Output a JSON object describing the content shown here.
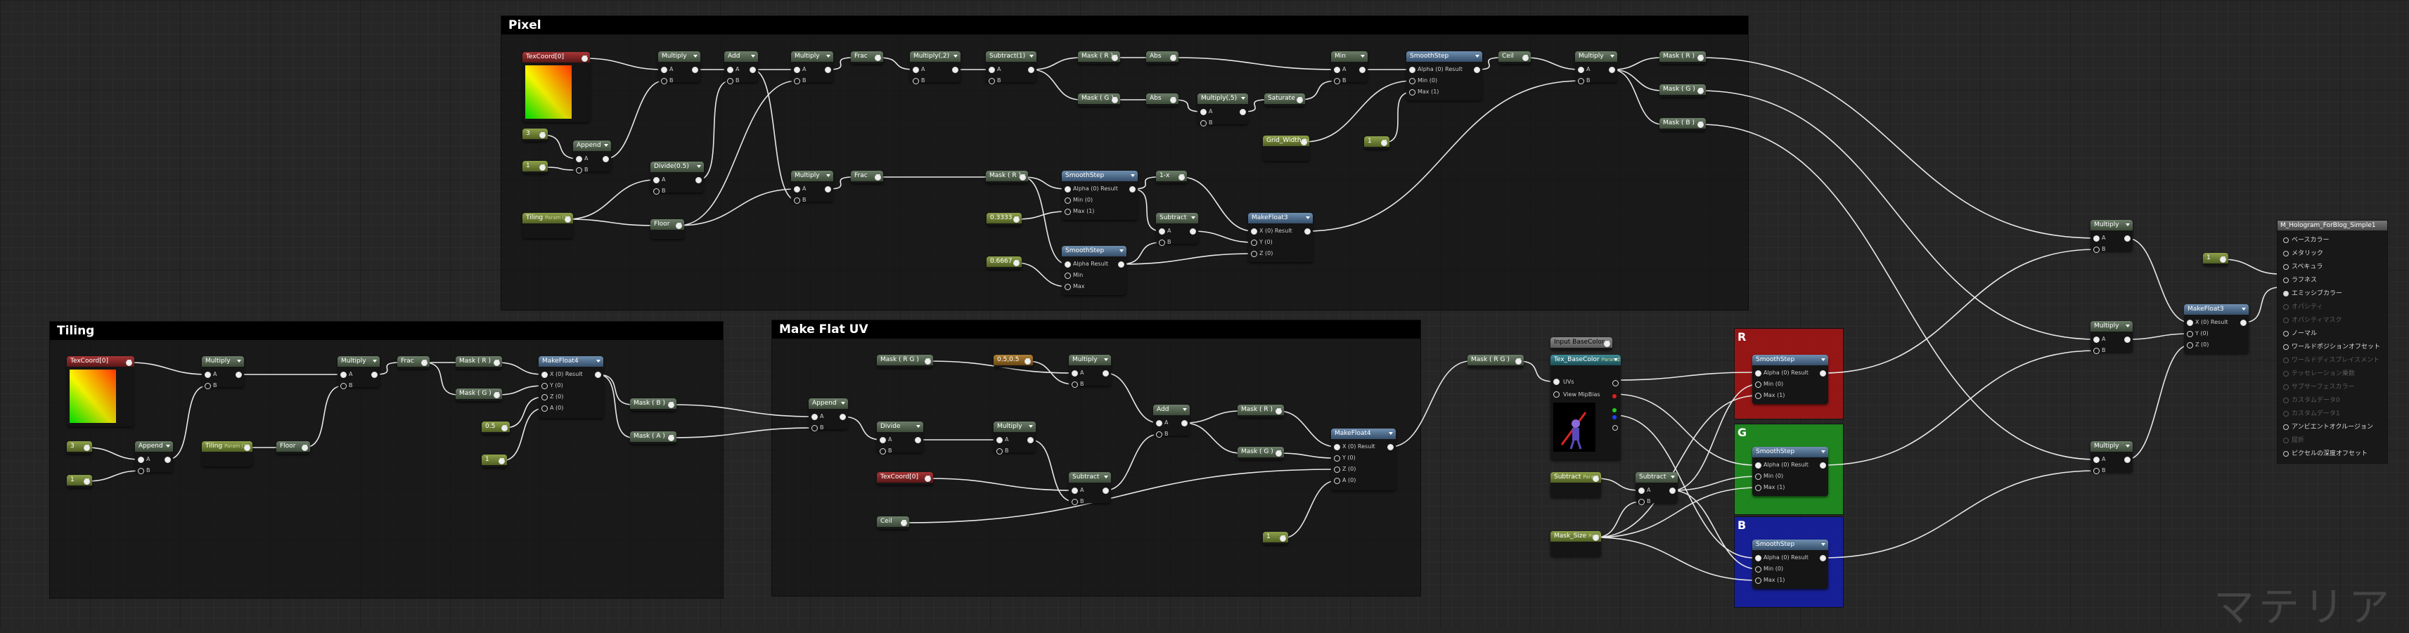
{
  "comments": {
    "pixel": "Pixel",
    "tiling": "Tiling",
    "flat_uv": "Make Flat UV",
    "r": "R",
    "g": "G",
    "b": "B"
  },
  "nodes": {
    "texcoord_pixel": "TexCoord[0]",
    "const3_a": "3",
    "const1_a": "1",
    "append_a": "Append",
    "tiling_param": "Tiling",
    "tiling_param_sub": "Param (1)",
    "multiply_a": "Multiply",
    "divide_a": "Divide(0.5)",
    "floor_a": "Floor",
    "add_a": "Add",
    "multiply_b": "Multiply",
    "multiply_c": "Multiply",
    "frac_a": "Frac",
    "frac_b": "Frac",
    "multiply_2": "Multiply(,2)",
    "subtract_1": "Subtract(1)",
    "mask_r_a": "Mask ( R )",
    "mask_g_a": "Mask ( G )",
    "abs_a": "Abs",
    "abs_b": "Abs",
    "multiply_5": "Multiply(,5)",
    "saturate": "Saturate",
    "min": "Min",
    "grid_width": "Grid_Width",
    "grid_width_sub": "Param (0.1)",
    "const1_b": "1",
    "smoothstep_a": "SmoothStep",
    "ceil_a": "Ceil",
    "multiply_d": "Multiply",
    "mask_r_b": "Mask ( R )",
    "mask_g_b": "Mask ( G )",
    "mask_b_b": "Mask ( B )",
    "mask_r_c": "Mask ( R )",
    "smoothstep_b": "SmoothStep",
    "const_3333": "0.3333",
    "const_6667": "0.6667",
    "smoothstep_c": "SmoothStep",
    "subtract_a": "Subtract",
    "one_minus": "1-x",
    "makefloat3_a": "MakeFloat3",
    "texcoord_tiling": "TexCoord[0]",
    "const3_b": "3",
    "const1_c": "1",
    "append_b": "Append",
    "tiling_param2": "Tiling",
    "tiling_param2_sub": "Param (1)",
    "multiply_e": "Multiply",
    "floor_b": "Floor",
    "multiply_f": "Multiply",
    "frac_c": "Frac",
    "mask_r_d": "Mask ( R )",
    "mask_g_d": "Mask ( G )",
    "const_05": "0.5",
    "const1_d": "1",
    "makefloat4_a": "MakeFloat4",
    "mask_rg": "Mask ( R G )",
    "append_c": "Append",
    "divide_b": "Divide",
    "texcoord_flat": "TexCoord[0]",
    "ceil_b": "Ceil",
    "const_05b": "0.5,0.5",
    "multiply_g": "Multiply",
    "multiply_h": "Multiply",
    "subtract_b": "Subtract",
    "add_b": "Add",
    "mask_r_e": "Mask ( R )",
    "mask_g_e": "Mask ( G )",
    "makefloat4_b": "MakeFloat4",
    "const1_e": "1",
    "mask_b_c": "Mask ( B )",
    "mask_a_c": "Mask ( A )",
    "mask_rg_b": "Mask ( R G )",
    "input_basecolor": "Input BaseColor",
    "tex_basecolor": "Tex_BaseColor",
    "tex_basecolor_sub": "Param2D",
    "uvs": "UVs",
    "view_mipbias": "View MipBias",
    "subtract_p": "Subtract",
    "subtract_p_sub": "Param (0)",
    "mask_size": "Mask_Size",
    "mask_size_sub": "Param (0)",
    "subtract_c": "Subtract",
    "smoothstep_r": "SmoothStep",
    "smoothstep_g": "SmoothStep",
    "smoothstep_b2": "SmoothStep",
    "multiply_r": "Multiply",
    "multiply_gg": "Multiply",
    "multiply_bb": "Multiply",
    "const1_f": "1",
    "makefloat3_b": "MakeFloat3"
  },
  "pins": {
    "a": "A",
    "b": "B",
    "alpha_result": "Alpha (0) Result",
    "min": "Min (0)",
    "max": "Max (1)",
    "alpha": "Alpha Result",
    "min_plain": "Min",
    "max_plain": "Max",
    "x_result": "X (0) Result",
    "y": "Y (0)",
    "z": "Z (0)",
    "w": "A (0)"
  },
  "material_output": {
    "title": "M_Hologram_ForBlog_Simple1",
    "rows": [
      {
        "label": "ベースカラー",
        "active": false,
        "dim": false
      },
      {
        "label": "メタリック",
        "active": false,
        "dim": false
      },
      {
        "label": "スペキュラ",
        "active": false,
        "dim": false
      },
      {
        "label": "ラフネス",
        "active": false,
        "dim": false
      },
      {
        "label": "エミッシブカラー",
        "active": true,
        "dim": false
      },
      {
        "label": "オパシティ",
        "active": false,
        "dim": true
      },
      {
        "label": "オパシティマスク",
        "active": false,
        "dim": true
      },
      {
        "label": "ノーマル",
        "active": false,
        "dim": false
      },
      {
        "label": "ワールドポジションオフセット",
        "active": false,
        "dim": false
      },
      {
        "label": "ワールドディスプレイスメント",
        "active": false,
        "dim": true
      },
      {
        "label": "テッセレーション乗数",
        "active": false,
        "dim": true
      },
      {
        "label": "サブサーフェスカラー",
        "active": false,
        "dim": true
      },
      {
        "label": "カスタムデータ0",
        "active": false,
        "dim": true
      },
      {
        "label": "カスタムデータ1",
        "active": false,
        "dim": true
      },
      {
        "label": "アンビエントオクルージョン",
        "active": false,
        "dim": false
      },
      {
        "label": "屈折",
        "active": false,
        "dim": true
      },
      {
        "label": "ピクセルの深度オフセット",
        "active": false,
        "dim": false
      }
    ]
  },
  "watermark": "マテリア"
}
